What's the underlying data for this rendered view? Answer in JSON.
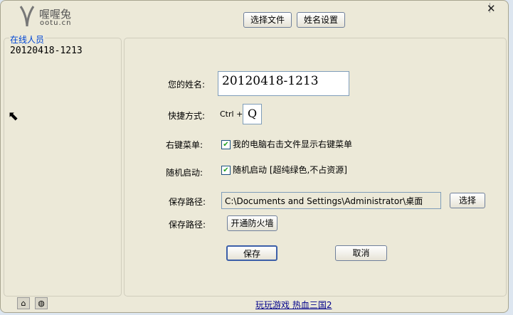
{
  "logo": {
    "name": "喔喔兔",
    "domain": "ootu.cn"
  },
  "toolbar": {
    "select_file": "选择文件",
    "name_settings": "姓名设置"
  },
  "sidebar": {
    "title": "在线人员",
    "users": [
      "20120418-1213"
    ]
  },
  "form": {
    "name_label": "您的姓名:",
    "name_value": "20120418-1213",
    "shortcut_label": "快捷方式:",
    "shortcut_prefix": "Ctrl +",
    "shortcut_key": "Q",
    "context_label": "右键菜单:",
    "context_text": "我的电脑右击文件显示右键菜单",
    "context_checked": true,
    "startup_label": "随机启动:",
    "startup_text": "随机启动 [超纯绿色,不占资源]",
    "startup_checked": true,
    "path_label": "保存路径:",
    "path_value": "C:\\Documents and Settings\\Administrator\\桌面",
    "browse": "选择",
    "firewall_label": "保存路径:",
    "firewall_button": "开通防火墙",
    "save": "保存",
    "cancel": "取消"
  },
  "footer": {
    "link": "玩玩游戏 热血三国2"
  }
}
